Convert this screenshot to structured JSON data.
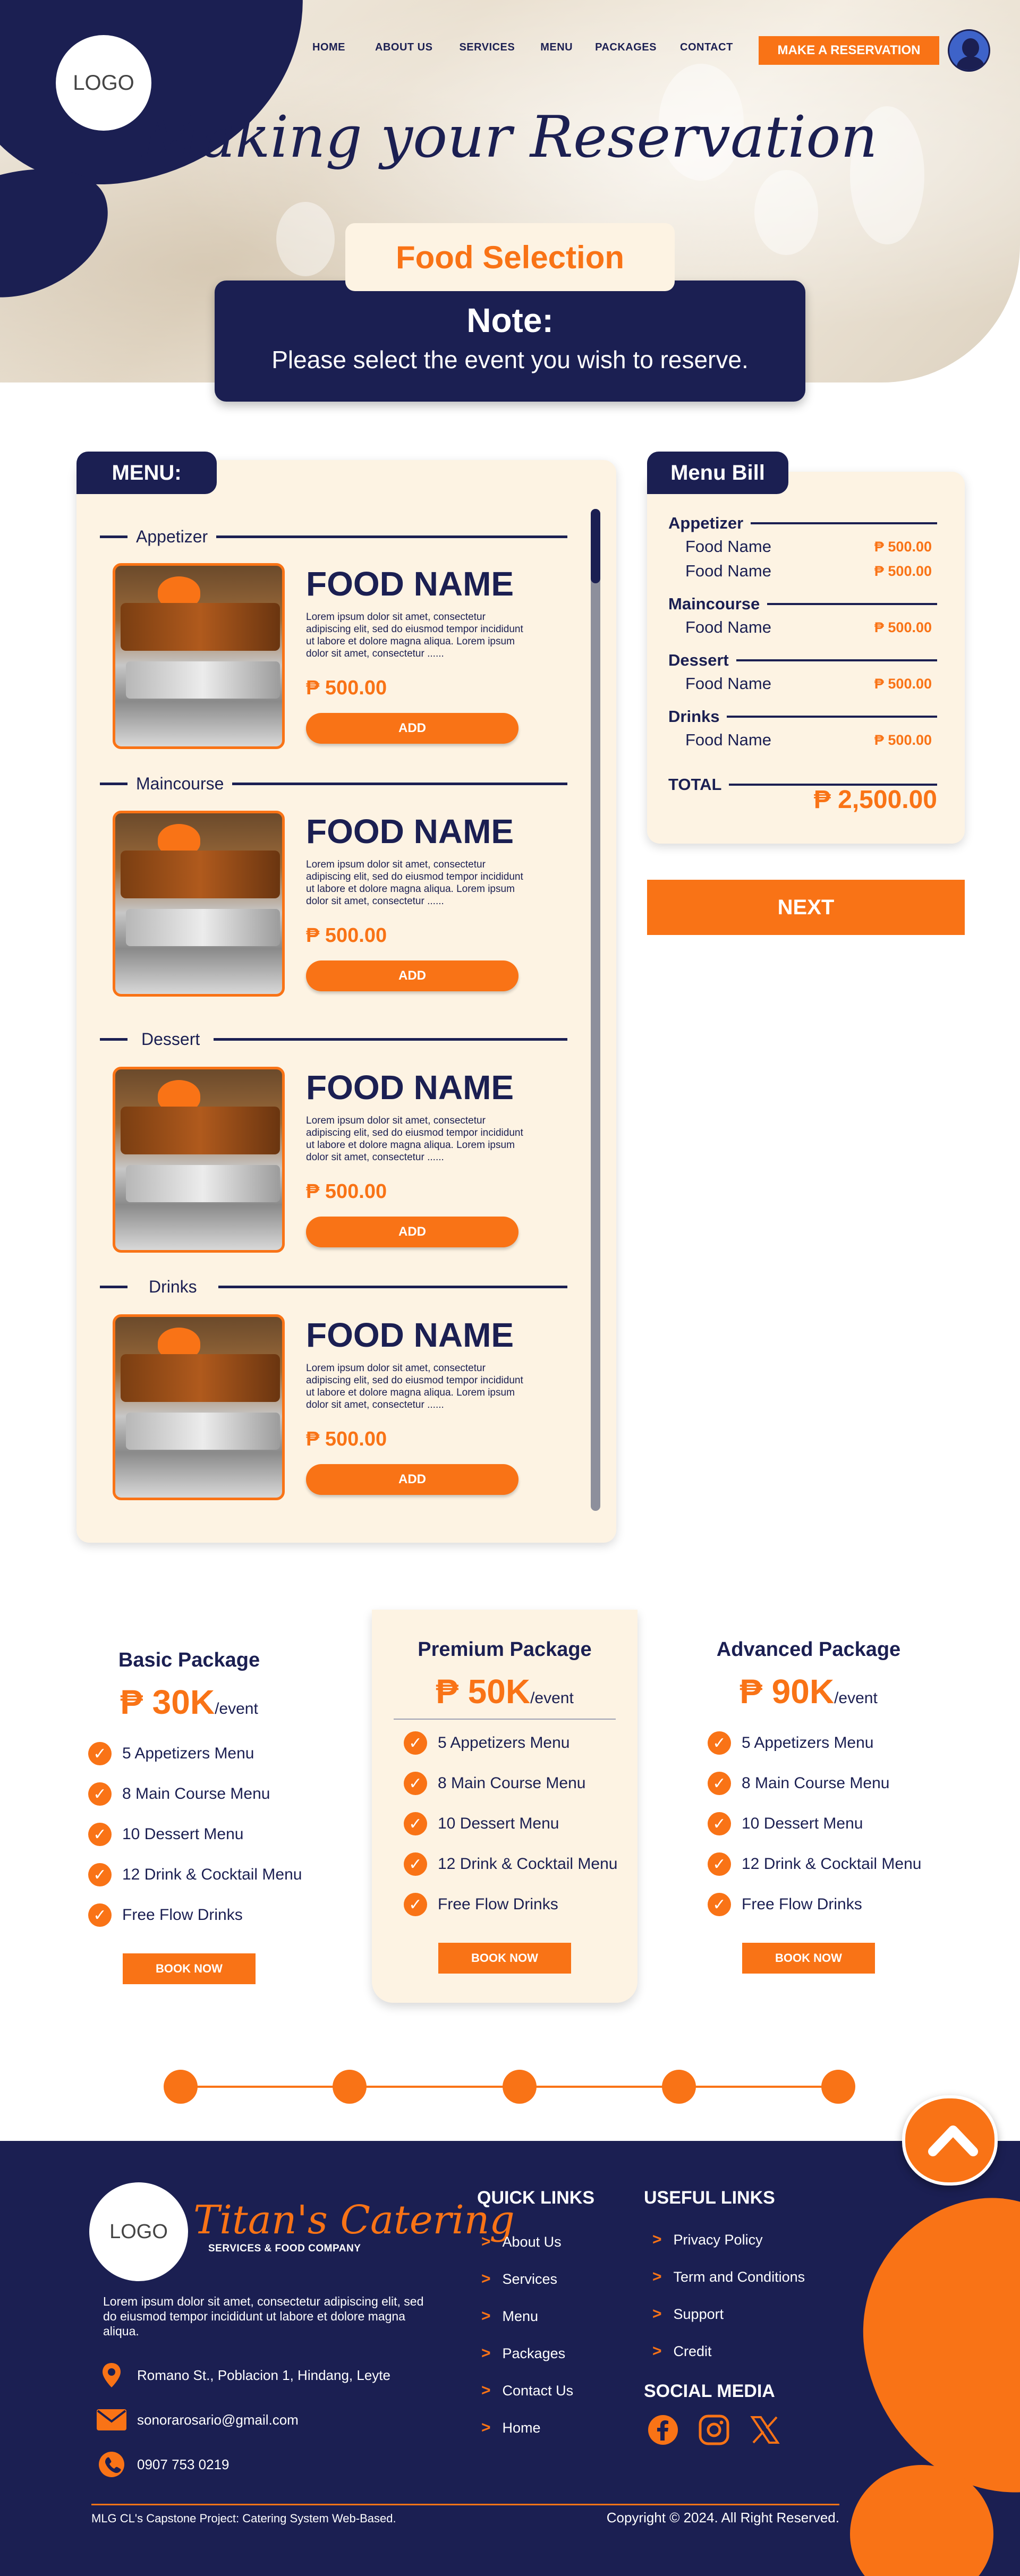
{
  "header": {
    "logo": "LOGO",
    "nav": [
      "HOME",
      "ABOUT US",
      "SERVICES",
      "MENU",
      "PACKAGES",
      "CONTACT"
    ],
    "reserve_button": "MAKE A RESERVATION",
    "title": "Making your Reservation"
  },
  "intro": {
    "badge": "Food Selection",
    "note_title": "Note:",
    "note_text": "Please select the event you wish to reserve."
  },
  "menu": {
    "tab_label": "MENU:",
    "sections": [
      {
        "category": "Appetizer",
        "name": "FOOD NAME",
        "description": "Lorem ipsum dolor sit amet, consectetur adipiscing elit, sed do eiusmod tempor incididunt ut labore et dolore magna aliqua. Lorem ipsum dolor sit amet, consectetur ......",
        "price": "₱ 500.00",
        "button": "ADD"
      },
      {
        "category": "Maincourse",
        "name": "FOOD NAME",
        "description": "Lorem ipsum dolor sit amet, consectetur adipiscing elit, sed do eiusmod tempor incididunt ut labore et dolore magna aliqua. Lorem ipsum dolor sit amet, consectetur ......",
        "price": "₱ 500.00",
        "button": "ADD"
      },
      {
        "category": "Dessert",
        "name": "FOOD NAME",
        "description": "Lorem ipsum dolor sit amet, consectetur adipiscing elit, sed do eiusmod tempor incididunt ut labore et dolore magna aliqua. Lorem ipsum dolor sit amet, consectetur ......",
        "price": "₱ 500.00",
        "button": "ADD"
      },
      {
        "category": "Drinks",
        "name": "FOOD NAME",
        "description": "Lorem ipsum dolor sit amet, consectetur adipiscing elit, sed do eiusmod tempor incididunt ut labore et dolore magna aliqua. Lorem ipsum dolor sit amet, consectetur ......",
        "price": "₱ 500.00",
        "button": "ADD"
      }
    ]
  },
  "bill": {
    "tab_label": "Menu Bill",
    "categories": [
      {
        "name": "Appetizer",
        "items": [
          {
            "name": "Food Name",
            "price": "₱ 500.00"
          },
          {
            "name": "Food Name",
            "price": "₱ 500.00"
          }
        ]
      },
      {
        "name": "Maincourse",
        "items": [
          {
            "name": "Food Name",
            "price": "₱ 500.00"
          }
        ]
      },
      {
        "name": "Dessert",
        "items": [
          {
            "name": "Food Name",
            "price": "₱ 500.00"
          }
        ]
      },
      {
        "name": "Drinks",
        "items": [
          {
            "name": "Food Name",
            "price": "₱ 500.00"
          }
        ]
      }
    ],
    "total_label": "TOTAL",
    "total_value": "₱ 2,500.00",
    "next_button": "NEXT"
  },
  "packages": [
    {
      "title": "Basic Package",
      "price": "₱ 30K",
      "unit": "/event",
      "features": [
        "5 Appetizers Menu",
        "8 Main Course Menu",
        "10 Dessert Menu",
        "12 Drink & Cocktail Menu",
        "Free Flow Drinks"
      ],
      "button": "BOOK NOW"
    },
    {
      "title": "Premium Package",
      "price": "₱ 50K",
      "unit": "/event",
      "features": [
        "5 Appetizers Menu",
        "8 Main Course Menu",
        "10 Dessert Menu",
        "12 Drink & Cocktail Menu",
        "Free Flow Drinks"
      ],
      "button": "BOOK NOW"
    },
    {
      "title": "Advanced Package",
      "price": "₱ 90K",
      "unit": "/event",
      "features": [
        "5 Appetizers Menu",
        "8 Main Course Menu",
        "10 Dessert Menu",
        "12 Drink & Cocktail Menu",
        "Free Flow Drinks"
      ],
      "button": "BOOK NOW"
    }
  ],
  "footer": {
    "logo": "LOGO",
    "brand": "Titan's Catering",
    "brand_sub": "SERVICES & FOOD COMPANY",
    "description": "Lorem ipsum dolor sit amet, consectetur adipiscing elit, sed do eiusmod tempor incididunt ut labore et dolore magna aliqua.",
    "address": "Romano St., Poblacion 1, Hindang, Leyte",
    "email": "sonorarosario@gmail.com",
    "phone": "0907 753 0219",
    "quick_links_title": "QUICK LINKS",
    "quick_links": [
      "About Us",
      "Services",
      "Menu",
      "Packages",
      "Contact Us",
      "Home"
    ],
    "useful_links_title": "USEFUL LINKS",
    "useful_links": [
      "Privacy Policy",
      "Term and Conditions",
      "Support",
      "Credit"
    ],
    "social_title": "SOCIAL MEDIA",
    "social": [
      "facebook-icon",
      "instagram-icon",
      "x-icon"
    ],
    "bottom_left": "MLG CL's Capstone Project: Catering System Web-Based.",
    "bottom_right": "Copyright © 2024. All Right Reserved."
  },
  "colors": {
    "navy": "#1b1f52",
    "orange": "#f97316",
    "cream": "#fdf3e3"
  }
}
